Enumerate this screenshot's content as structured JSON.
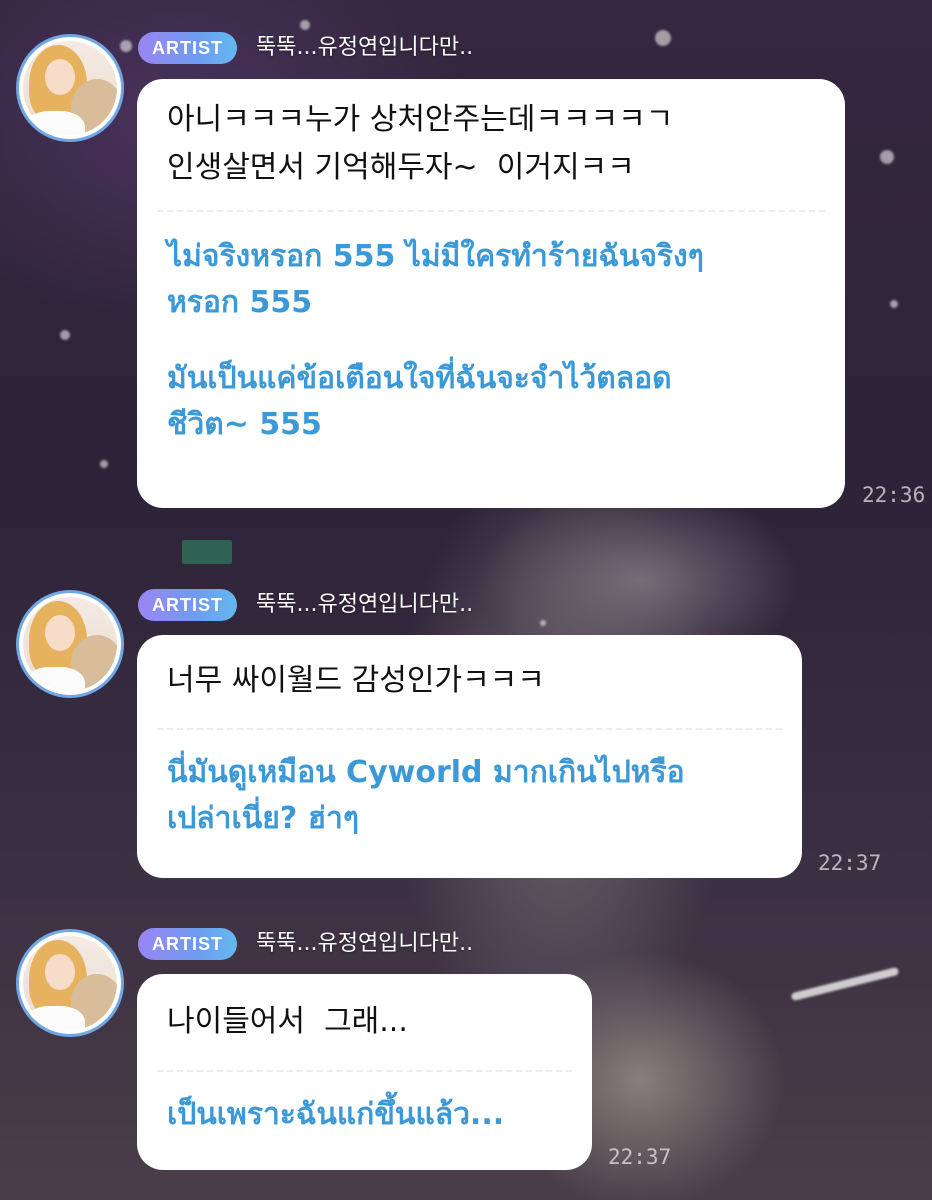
{
  "messages": [
    {
      "badge": "ARTIST",
      "sender": "뚝뚝...유정연입니다만..",
      "original_lines": [
        "아니ㅋㅋㅋ누가 상처안주는데ㅋㅋㅋㅋㄱ",
        "인생살면서 기억해두자~  이거지ㅋㅋ"
      ],
      "translation_paragraphs": [
        "ไม่จริงหรอก 555 ไม่มีใครทำร้ายฉันจริงๆ\nหรอก 555",
        "มันเป็นแค่ข้อเตือนใจที่ฉันจะจำไว้ตลอด\nชีวิต~ 555"
      ],
      "time": "22:36"
    },
    {
      "badge": "ARTIST",
      "sender": "뚝뚝...유정연입니다만..",
      "original_lines": [
        "너무 싸이월드 감성인가ㅋㅋㅋ"
      ],
      "translation_paragraphs": [
        "นี่มันดูเหมือน Cyworld มากเกินไปหรือ\nเปล่าเนี่ย? ฮ่าๆ"
      ],
      "time": "22:37"
    },
    {
      "badge": "ARTIST",
      "sender": "뚝뚝...유정연입니다만..",
      "original_lines": [
        "나이들어서  그래..."
      ],
      "translation_paragraphs": [
        "เป็นเพราะฉันแก่ขึ้นแล้ว..."
      ],
      "time": "22:37"
    }
  ]
}
